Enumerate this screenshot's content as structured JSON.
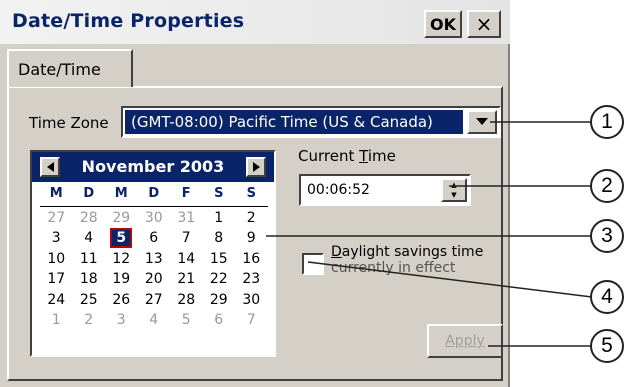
{
  "window": {
    "title": "Date/Time Properties",
    "ok_label": "OK",
    "close_glyph": "×"
  },
  "tabs": [
    {
      "label": "Date/Time",
      "active": true
    }
  ],
  "time_zone": {
    "label": "Time Zone",
    "value": "(GMT-08:00) Pacific Time (US & Canada)",
    "dropdown_icon": "triangle-down-icon"
  },
  "calendar": {
    "month_label": "November 2003",
    "prev_icon": "triangle-left-icon",
    "next_icon": "triangle-right-icon",
    "weekdays": [
      "M",
      "D",
      "M",
      "D",
      "F",
      "S",
      "S"
    ],
    "weeks": [
      [
        {
          "d": "27",
          "m": true
        },
        {
          "d": "28",
          "m": true
        },
        {
          "d": "29",
          "m": true
        },
        {
          "d": "30",
          "m": true
        },
        {
          "d": "31",
          "m": true
        },
        {
          "d": "1"
        },
        {
          "d": "2"
        }
      ],
      [
        {
          "d": "3"
        },
        {
          "d": "4"
        },
        {
          "d": "5",
          "sel": true
        },
        {
          "d": "6"
        },
        {
          "d": "7"
        },
        {
          "d": "8"
        },
        {
          "d": "9"
        }
      ],
      [
        {
          "d": "10"
        },
        {
          "d": "11"
        },
        {
          "d": "12"
        },
        {
          "d": "13"
        },
        {
          "d": "14"
        },
        {
          "d": "15"
        },
        {
          "d": "16"
        }
      ],
      [
        {
          "d": "17"
        },
        {
          "d": "18"
        },
        {
          "d": "19"
        },
        {
          "d": "20"
        },
        {
          "d": "21"
        },
        {
          "d": "22"
        },
        {
          "d": "23"
        }
      ],
      [
        {
          "d": "24"
        },
        {
          "d": "25"
        },
        {
          "d": "26"
        },
        {
          "d": "27"
        },
        {
          "d": "28"
        },
        {
          "d": "29"
        },
        {
          "d": "30"
        }
      ],
      [
        {
          "d": "1",
          "m": true
        },
        {
          "d": "2",
          "m": true
        },
        {
          "d": "3",
          "m": true
        },
        {
          "d": "4",
          "m": true
        },
        {
          "d": "5",
          "m": true
        },
        {
          "d": "6",
          "m": true
        },
        {
          "d": "7",
          "m": true
        }
      ]
    ]
  },
  "current_time": {
    "label_pre": "Current ",
    "label_u": "T",
    "label_post": "ime",
    "value": "00:06:52",
    "up_glyph": "▲",
    "down_glyph": "▼"
  },
  "daylight": {
    "label_u": "D",
    "label_line1": "aylight savings time",
    "label_line2": "currently in effect",
    "checked": false
  },
  "apply_label": "Apply",
  "callouts": [
    "1",
    "2",
    "3",
    "4",
    "5"
  ],
  "colors": {
    "accent": "#0a246a",
    "selection_outline": "#c00000",
    "dialog_bg": "#d4d0c8"
  }
}
